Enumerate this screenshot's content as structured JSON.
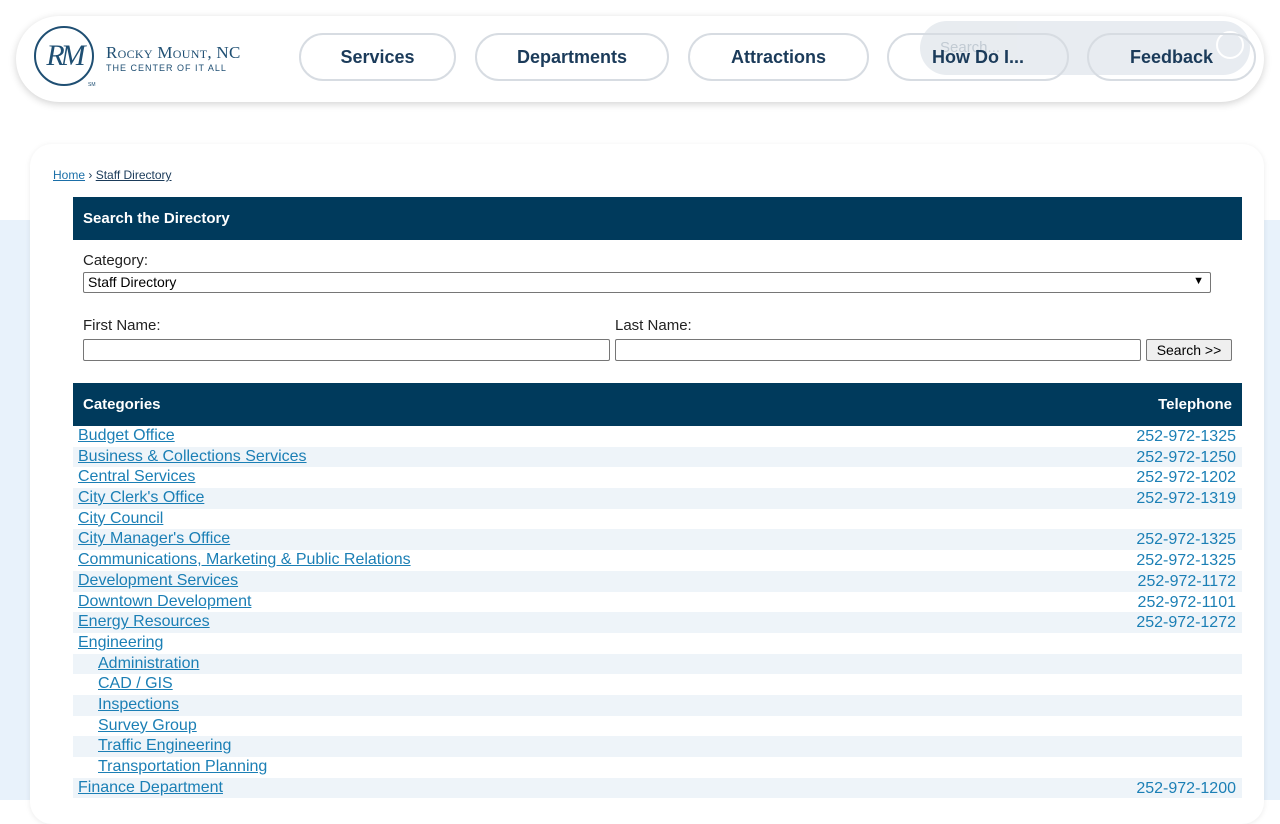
{
  "header": {
    "logo_mark": "RM",
    "logo_sm": "SM",
    "logo_name": "Rocky Mount, NC",
    "logo_tagline": "THE CENTER OF IT ALL",
    "nav": [
      {
        "label": "Services"
      },
      {
        "label": "Departments"
      },
      {
        "label": "Attractions"
      },
      {
        "label": "How Do I..."
      },
      {
        "label": "Feedback"
      }
    ],
    "search_placeholder": "Search..."
  },
  "breadcrumb": {
    "home": "Home",
    "separator": "›",
    "current": "Staff Directory"
  },
  "search_panel": {
    "title": "Search the Directory",
    "category_label": "Category:",
    "category_selected": "Staff Directory",
    "first_name_label": "First Name:",
    "last_name_label": "Last Name:",
    "search_button": "Search >>"
  },
  "directory": {
    "col_categories": "Categories",
    "col_telephone": "Telephone",
    "rows": [
      {
        "name": "Budget Office",
        "phone": "252-972-1325",
        "indent": false
      },
      {
        "name": "Business & Collections Services",
        "phone": "252-972-1250",
        "indent": false
      },
      {
        "name": "Central Services",
        "phone": "252-972-1202",
        "indent": false
      },
      {
        "name": "City Clerk's Office",
        "phone": "252-972-1319",
        "indent": false
      },
      {
        "name": "City Council",
        "phone": "",
        "indent": false
      },
      {
        "name": "City Manager's Office",
        "phone": "252-972-1325",
        "indent": false
      },
      {
        "name": "Communications, Marketing & Public Relations",
        "phone": "252-972-1325",
        "indent": false
      },
      {
        "name": "Development Services",
        "phone": "252-972-1172",
        "indent": false
      },
      {
        "name": "Downtown Development",
        "phone": "252-972-1101",
        "indent": false
      },
      {
        "name": "Energy Resources",
        "phone": "252-972-1272",
        "indent": false
      },
      {
        "name": "Engineering",
        "phone": "",
        "indent": false
      },
      {
        "name": "Administration",
        "phone": "",
        "indent": true
      },
      {
        "name": "CAD / GIS",
        "phone": "",
        "indent": true
      },
      {
        "name": "Inspections",
        "phone": "",
        "indent": true
      },
      {
        "name": "Survey Group",
        "phone": "",
        "indent": true
      },
      {
        "name": "Traffic Engineering",
        "phone": "",
        "indent": true
      },
      {
        "name": "Transportation Planning",
        "phone": "",
        "indent": true
      },
      {
        "name": "Finance Department",
        "phone": "252-972-1200",
        "indent": false
      }
    ]
  }
}
